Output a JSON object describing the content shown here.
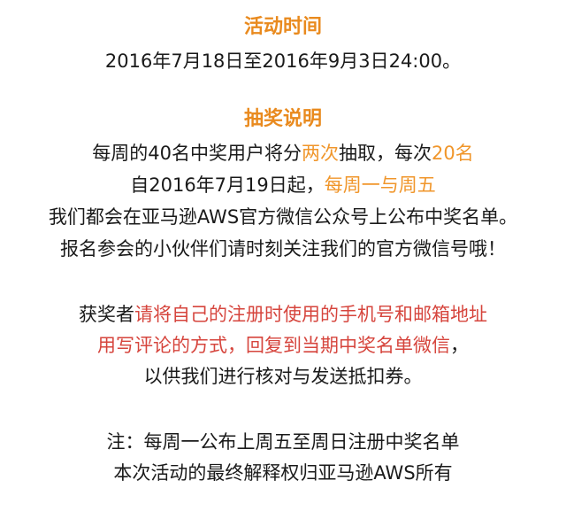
{
  "colors": {
    "heading": "#e98a1e",
    "highlight_orange": "#f0962b",
    "highlight_red": "#d6453d",
    "text": "#1a1a1a"
  },
  "activity_time": {
    "heading": "活动时间",
    "dates": "2016年7月18日至2016年9月3日24:00。"
  },
  "lottery": {
    "heading": "抽奖说明",
    "line1_a": "每周的40名中奖用户将分",
    "line1_b": "两次",
    "line1_c": "抽取，每次",
    "line1_d": "20名",
    "line2_a": "自2016年7月19日起，",
    "line2_b": "每周一与周五",
    "line3": "我们都会在亚马逊AWS官方微信公众号上公布中奖名单。",
    "line4": "报名参会的小伙伴们请时刻关注我们的官方微信号哦！"
  },
  "winner": {
    "line1_a": "获奖者",
    "line1_b": "请将自己的注册时使用的手机号和邮箱地址",
    "line2_a": "用写评论的方式，回复到当期中奖名单微信",
    "line2_b": "，",
    "line3": "以供我们进行核对与发送抵扣券。"
  },
  "note": {
    "line1": "注：每周一公布上周五至周日注册中奖名单",
    "line2": "本次活动的最终解释权归亚马逊AWS所有"
  }
}
